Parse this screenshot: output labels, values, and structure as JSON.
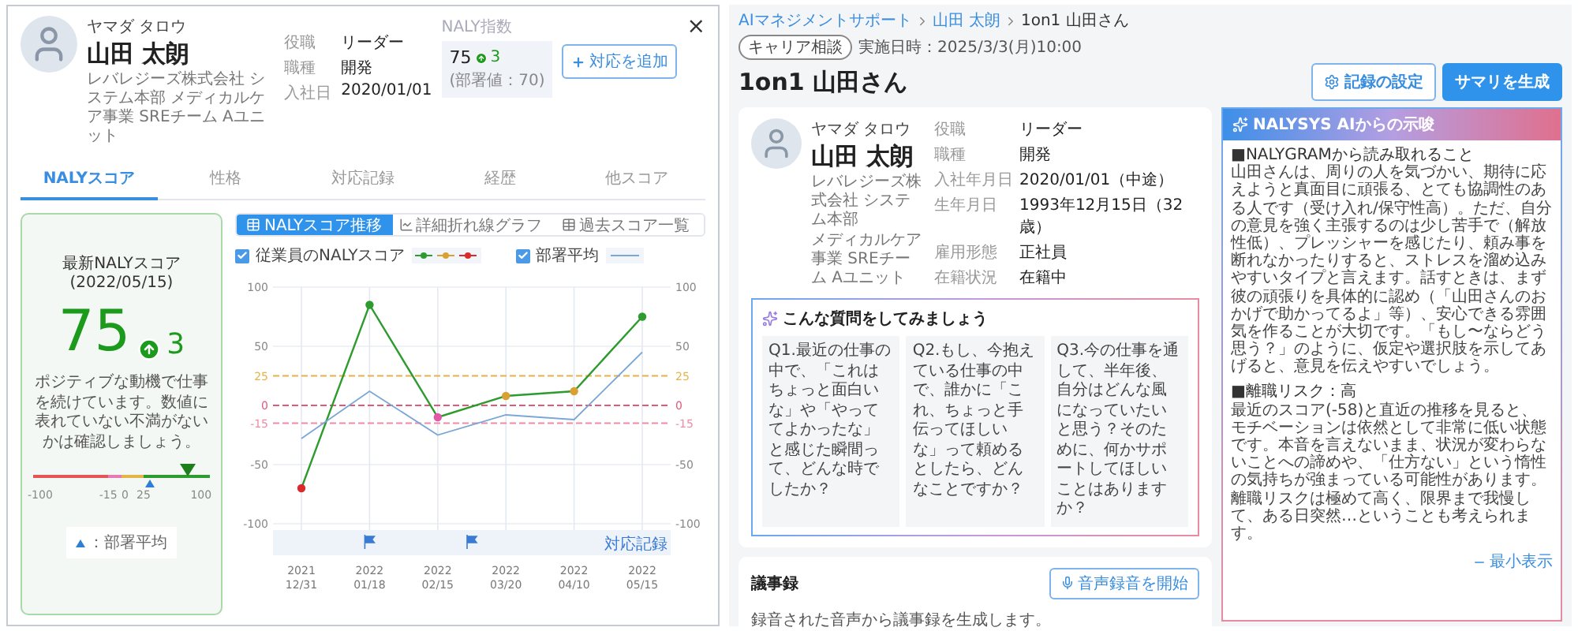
{
  "left_panel": {
    "close": "×",
    "profile": {
      "kana": "ヤマダ タロウ",
      "name": "山田 太朗",
      "organization": "レバレジーズ株式会社 システム本部 メディカルケア事業 SREチーム Aユニット",
      "fields": [
        {
          "label": "役職",
          "value": "リーダー"
        },
        {
          "label": "職種",
          "value": "開発"
        },
        {
          "label": "入社日",
          "value": "2020/01/01"
        }
      ]
    },
    "naly_index": {
      "label": "NALY指数",
      "score": "75",
      "delta": "3",
      "department": "(部署値：70)"
    },
    "add_button": "対応を追加",
    "tabs": [
      {
        "label": "NALYスコア",
        "selected": true
      },
      {
        "label": "性格",
        "selected": false
      },
      {
        "label": "対応記録",
        "selected": false
      },
      {
        "label": "経歴",
        "selected": false
      },
      {
        "label": "他スコア",
        "selected": false
      }
    ],
    "score_card": {
      "title": "最新NALYスコア (2022/05/15)",
      "score": "75",
      "delta": "3",
      "message": "ポジティブな動機で仕事を続けています。数値に表れていない不満がないかは確認しましょう。",
      "gauge": {
        "level": 0.875,
        "ticks": [
          "-100",
          "-15",
          "0",
          "25",
          "100"
        ]
      },
      "department_marker": {
        "level": 0.66
      },
      "legend": "：部署平均"
    },
    "chart_tabs": [
      {
        "label": "NALYスコア推移",
        "selected": true
      },
      {
        "label": "詳細折れ線グラフ",
        "selected": false
      },
      {
        "label": "過去スコア一覧",
        "selected": false
      }
    ],
    "legend": [
      {
        "checked": true
      },
      {
        "checked": true
      }
    ],
    "records_label": "対応記録",
    "chart_data": {
      "type": "line",
      "categories": [
        "2021 12/31",
        "2022 01/18",
        "2022 02/15",
        "2022 03/20",
        "2022 04/10",
        "2022 05/15"
      ],
      "ylim": [
        -100,
        100
      ],
      "yticks": [
        -100,
        -50,
        -15,
        0,
        25,
        50,
        100
      ],
      "y2ticks": [
        -100,
        -50,
        -15,
        0,
        25,
        50,
        100
      ],
      "y2lim": [
        -100,
        100
      ],
      "grid": true,
      "ref_lines": [
        {
          "axis": "y",
          "value": 25,
          "color": "#e4b44a"
        },
        {
          "axis": "y",
          "value": 0,
          "color": "#e05a7a"
        },
        {
          "axis": "y",
          "value": -15,
          "color": "#f08aa6"
        }
      ],
      "series": [
        {
          "name": "従業員のNALYスコア",
          "color": "#2e9b2e",
          "marker": "circle",
          "values": [
            -70,
            85,
            -10,
            8,
            12,
            75
          ]
        },
        {
          "name": "部署平均",
          "color": "#7aa7d6",
          "values": [
            -28,
            12,
            -25,
            -8,
            -12,
            45
          ]
        }
      ]
    }
  },
  "right_panel": {
    "breadcrumb": [
      {
        "label": "AIマネジメントサポート",
        "kind": "link"
      },
      {
        "label": "山田 太朗",
        "kind": "link"
      },
      {
        "label": "1on1 山田さん",
        "kind": "current"
      }
    ],
    "tag": "キャリア相談",
    "datetime": "実施日時：2025/3/3(月)10:00",
    "title": "1on1 山田さん",
    "buttons": [
      {
        "label": "記録の設定",
        "kind": "secondary"
      },
      {
        "label": "サマリを生成",
        "kind": "primary"
      }
    ],
    "profile": {
      "kana": "ヤマダ タロウ",
      "name": "山田 太朗",
      "organization": [
        "レバレジーズ株式会社 システム本部",
        "メディカルケア事業 SREチーム Aユニット"
      ],
      "fields": [
        {
          "label": "役職",
          "value": "リーダー"
        },
        {
          "label": "職種",
          "value": "開発"
        },
        {
          "label": "入社年月日",
          "value": "2020/01/01（中途）"
        },
        {
          "label": "生年月日",
          "value": "1993年12月15日（32歳）"
        },
        {
          "label": "雇用形態",
          "value": "正社員"
        },
        {
          "label": "在籍状況",
          "value": "在籍中"
        }
      ]
    },
    "questions": {
      "title": "こんな質問をしてみましょう",
      "items": [
        "Q1.最近の仕事の中で、「これはちょっと面白いな」や「やっててよかったな」と感じた瞬間って、どんな時でしたか？",
        "Q2.もし、今抱えている仕事の中で、誰かに「これ、ちょっと手伝ってほしいな」って頼めるとしたら、どんなことですか？",
        "Q3.今の仕事を通して、半年後、自分はどんな風になっていたいと思う？そのために、何かサポートしてほしいことはありますか？"
      ]
    },
    "minutes": {
      "title": "議事録",
      "button": "音声録音を開始",
      "description": "録音された音声から議事録を生成します。"
    },
    "ai_panel": {
      "title": "NALYSYS AIからの示唆",
      "sections": [
        {
          "heading": "■NALYGRAMから読み取れること",
          "body": "山田さんは、周りの人を気づかい、期待に応えようと真面目に頑張る、とても協調性のある人です（受け入れ/保守性高）。ただ、自分の意見を強く主張するのは少し苦手で（解放性低）、プレッシャーを感じたり、頼み事を断れなかったりすると、ストレスを溜め込みやすいタイプと言えます。話すときは、まず彼の頑張りを具体的に認め（「山田さんのおかげで助かってるよ」等）、安心できる雰囲気を作ることが大切です。「もし〜ならどう思う？」のように、仮定や選択肢を示してあげると、意見を伝えやすいでしょう。"
        },
        {
          "heading": "■離職リスク：高",
          "body": "最近のスコア(-58)と直近の推移を見ると、モチベーションは依然として非常に低い状態です。本音を言えないまま、状況が変わらないことへの諦めや、「仕方ない」という惰性の気持ちが強まっている可能性があります。離職リスクは極めて高く、限界まで我慢して、ある日突然…ということも考えられます。"
        }
      ],
      "collapse": "最小表示"
    }
  }
}
